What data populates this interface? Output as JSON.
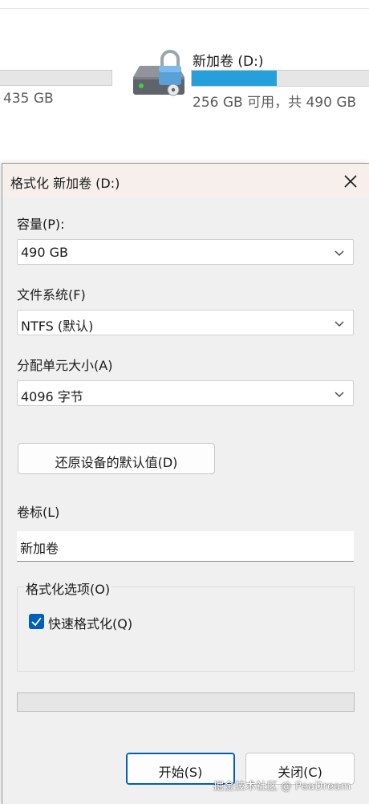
{
  "explorer": {
    "left_drive": {
      "space_text": "435 GB"
    },
    "drive": {
      "name": "新加卷 (D:)",
      "space_text": "256 GB 可用，共 490 GB",
      "used_fraction": 0.48,
      "bar_color": "#26a0da",
      "icon": "locked-drive-icon"
    }
  },
  "dialog": {
    "title": "格式化 新加卷 (D:)",
    "capacity": {
      "label": "容量(P):",
      "value": "490 GB"
    },
    "filesystem": {
      "label": "文件系统(F)",
      "value": "NTFS (默认)"
    },
    "allocation": {
      "label": "分配单元大小(A)",
      "value": "4096 字节"
    },
    "restore_defaults_label": "还原设备的默认值(D)",
    "volume_label": {
      "label": "卷标(L)",
      "value": "新加卷"
    },
    "format_options": {
      "legend": "格式化选项(O)",
      "quick_format_label": "快速格式化(Q)",
      "quick_format_checked": true
    },
    "progress": 0,
    "start_label": "开始(S)",
    "close_label": "关闭(C)",
    "accent_color": "#005fb8"
  },
  "watermark": "掘金技术社区 @ PeaDream"
}
